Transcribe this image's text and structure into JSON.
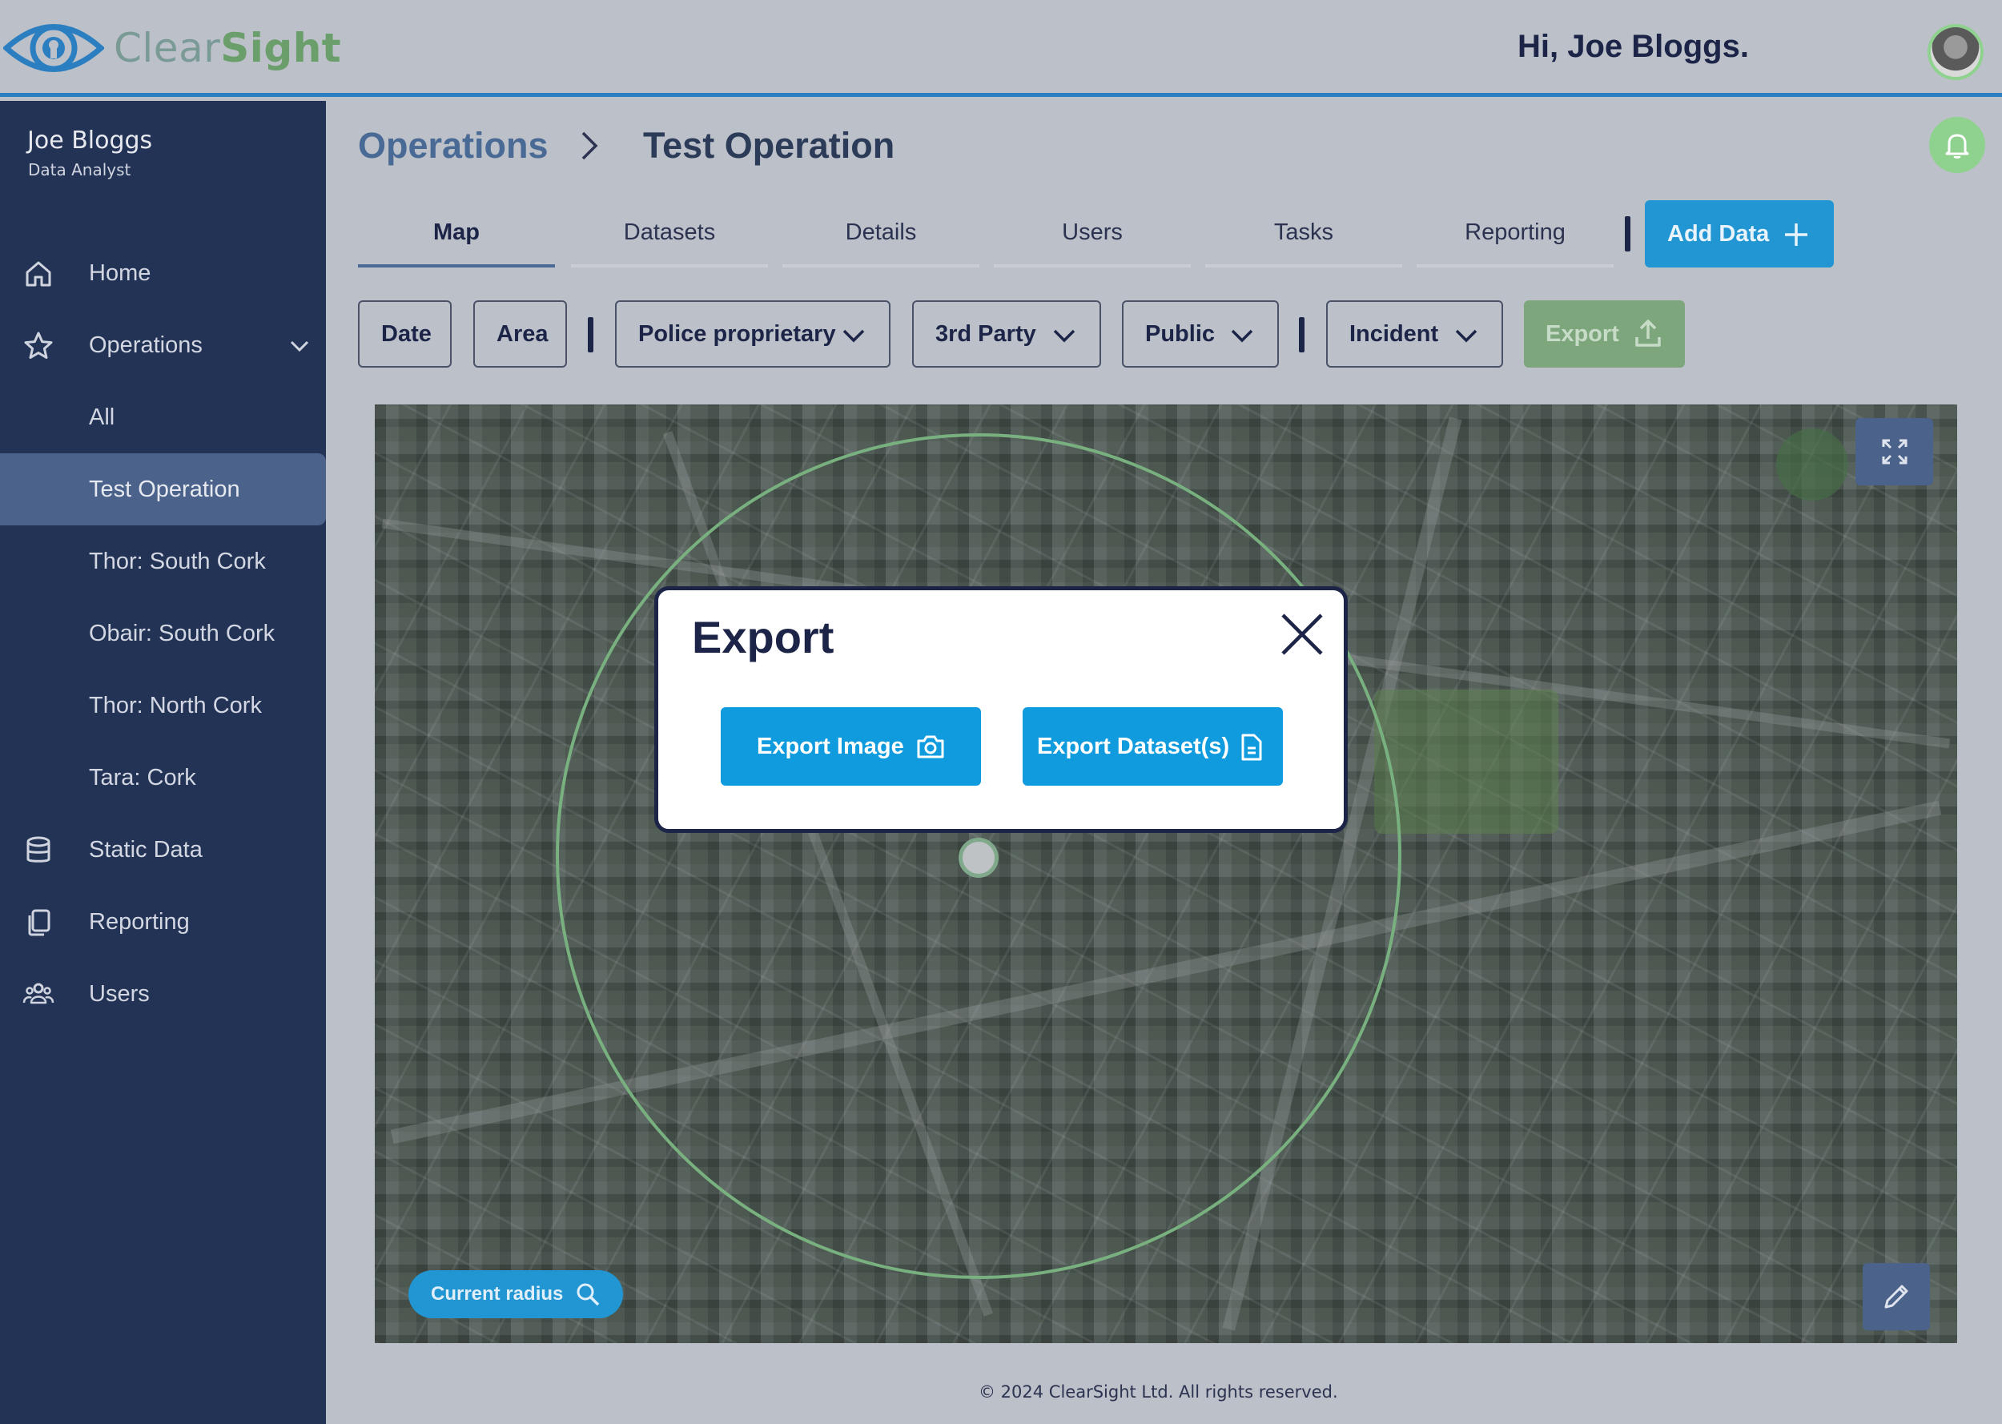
{
  "header": {
    "logo_part1": "Clear",
    "logo_part2": "Sight",
    "greeting": "Hi, Joe Bloggs."
  },
  "sidebar": {
    "user_name": "Joe Bloggs",
    "user_role": "Data Analyst",
    "items": [
      {
        "label": "Home",
        "icon": "home-icon"
      },
      {
        "label": "Operations",
        "icon": "star-icon"
      },
      {
        "label": "All"
      },
      {
        "label": "Test Operation"
      },
      {
        "label": "Thor: South Cork"
      },
      {
        "label": "Obair: South Cork"
      },
      {
        "label": "Thor: North Cork"
      },
      {
        "label": "Tara: Cork"
      },
      {
        "label": "Static Data",
        "icon": "database-icon"
      },
      {
        "label": "Reporting",
        "icon": "documents-icon"
      },
      {
        "label": "Users",
        "icon": "users-icon"
      }
    ]
  },
  "breadcrumb": {
    "parent": "Operations",
    "current": "Test Operation"
  },
  "tabs": [
    {
      "label": "Map"
    },
    {
      "label": "Datasets"
    },
    {
      "label": "Details"
    },
    {
      "label": "Users"
    },
    {
      "label": "Tasks"
    },
    {
      "label": "Reporting"
    }
  ],
  "add_data_label": "Add Data",
  "filters": {
    "date": "Date",
    "area": "Area",
    "police": "Police proprietary",
    "third_party": "3rd Party",
    "public": "Public",
    "incident": "Incident",
    "export": "Export"
  },
  "map": {
    "current_radius_label": "Current radius"
  },
  "modal": {
    "title": "Export",
    "export_image": "Export Image",
    "export_datasets": "Export Dataset(s)"
  },
  "footer": "© 2024 ClearSight Ltd. All rights reserved.",
  "colors": {
    "accent": "#2196d3",
    "sidebar": "#233356",
    "success": "#8fd18f"
  }
}
